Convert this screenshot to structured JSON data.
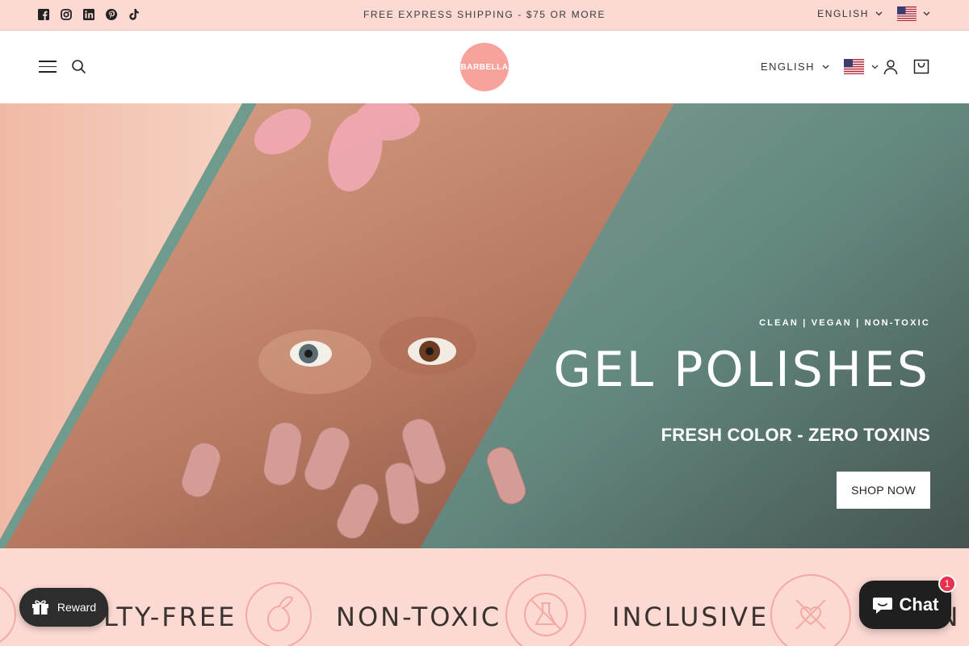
{
  "announcement": {
    "text": "FREE EXPRESS SHIPPING - $75 OR MORE",
    "social_icons": [
      "facebook-icon",
      "instagram-icon",
      "linkedin-icon",
      "pinterest-icon",
      "tiktok-icon"
    ]
  },
  "locale_top": {
    "language": "ENGLISH",
    "country_flag": "us-flag-icon"
  },
  "header": {
    "logo_text": "BARBELLA",
    "language": "ENGLISH",
    "country_flag": "us-flag-icon"
  },
  "hero": {
    "eyebrow": "CLEAN | VEGAN | NON-TOXIC",
    "title": "GEL POLISHES",
    "subtitle": "FRESH COLOR - ZERO TOXINS",
    "cta_label": "SHOP NOW"
  },
  "values": {
    "items": [
      "LTY-FREE",
      "NON-TOXIC",
      "INCLUSIVE",
      "IN"
    ]
  },
  "widgets": {
    "reward_label": "Reward",
    "chat_label": "Chat",
    "chat_badge": "1"
  },
  "colors": {
    "accent_pink": "#fcd9d3",
    "logo_coral": "#f7a39b",
    "chat_badge_red": "#e8314d"
  }
}
